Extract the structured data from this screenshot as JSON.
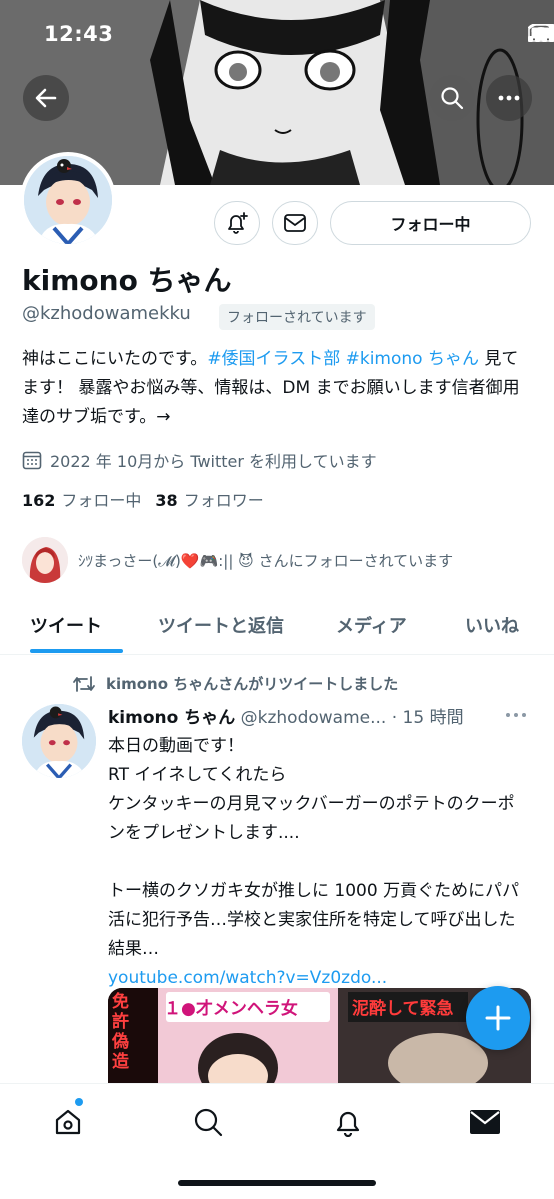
{
  "status_bar": {
    "time": "12:43"
  },
  "profile": {
    "display_name": "kimono ちゃん",
    "handle": "@kzhodowamekku",
    "follows_you": "フォローされています",
    "follow_button": "フォロー中",
    "bio": {
      "text_1": "神はここにいたのです。",
      "tag_1": "#倭国イラスト部",
      "tag_2": "#kimono ちゃん",
      "text_2": " 見てます！ 暴露やお悩み等、情報は、DM までお願いします信者御用達のサブ垢です。→"
    },
    "joined": "2022 年 10月から Twitter を利用しています",
    "following_count": "162",
    "following_label": "フォロー中",
    "followers_count": "38",
    "followers_label": "フォロワー",
    "followed_by": "ｼﾂまっさー(𝓜)❤️🎮:|| 😈 さんにフォローされています"
  },
  "tabs": [
    "ツイート",
    "ツイートと返信",
    "メディア",
    "いいね"
  ],
  "tweet": {
    "retweet_note": "kimono ちゃんさんがリツイートしました",
    "name": "kimono ちゃん",
    "meta": " @kzhodowame... · 15 時間",
    "lines": [
      "本日の動画です！",
      "RT イイネしてくれたら",
      "ケンタッキーの月見マックバーガーのポテトのクーポンをプレゼントします....",
      "",
      "トー横のクソガキ女が推しに 1000 万貢ぐためにパパ活に犯行予告…学校と実家住所を特定して呼び出した結果…"
    ],
    "link": "youtube.com/watch?v=Vz0zdo...",
    "media_text_1": "１●才メンヘラ女",
    "media_text_2": "泥酔して緊急",
    "media_text_3": "免許偽造"
  },
  "colors": {
    "accent": "#1d9bf0",
    "text": "#0f1419",
    "secondary": "#536471"
  },
  "icons": [
    "back-arrow-icon",
    "search-icon",
    "more-icon",
    "bell-plus-icon",
    "mail-icon",
    "calendar-icon",
    "retweet-icon",
    "plus-icon",
    "home-icon",
    "search-nav-icon",
    "notifications-icon",
    "messages-icon"
  ]
}
